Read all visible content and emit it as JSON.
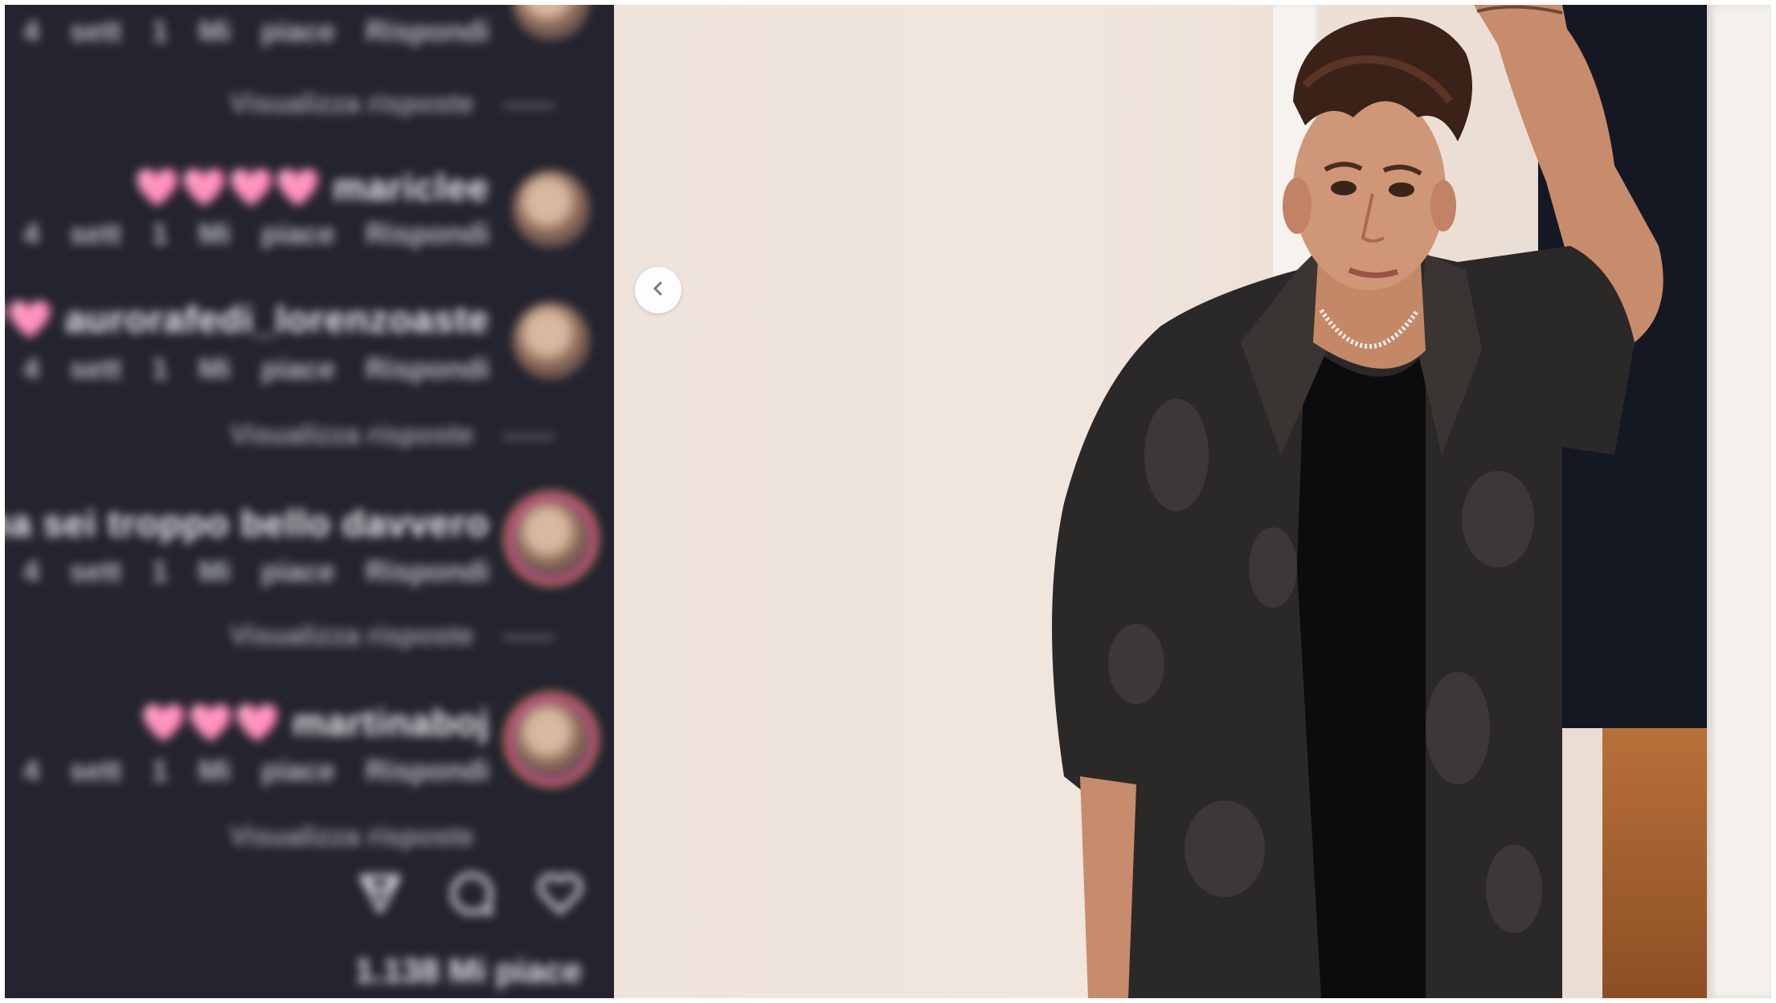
{
  "comments": [
    {
      "text": "",
      "meta": "4 sett   1 Mi piace   Rispondi"
    },
    {
      "text": "🩷🩷🩷🩷 mariclee",
      "meta": "4 sett   1 Mi piace   Rispondi"
    },
    {
      "text": "🩷🩷 aurorafedi_lorenzoaste",
      "meta": "4 sett   1 Mi piace   Rispondi"
    },
    {
      "text": "amore ma sei troppo bello davvero",
      "meta": "4 sett   1 Mi piace   Rispondi"
    },
    {
      "text": "🩷🩷🩷 martinaboj",
      "meta": "4 sett   1 Mi piace   Rispondi"
    }
  ],
  "view_replies": [
    "Visualizza risposte",
    "Visualizza risposte",
    "Visualizza risposte",
    "Visualizza risposte"
  ],
  "actions": {
    "icons": [
      "send-icon",
      "comment-icon",
      "heart-icon"
    ]
  },
  "likes": {
    "count": "1.138 Mi piace"
  },
  "photo": {
    "description_icon": "chevron-left-icon"
  },
  "colors": {
    "panel_bg": "#23242e",
    "story_ring_start": "#b23a8f",
    "story_ring_end": "#e4934d",
    "wall": "#efe4dc"
  }
}
